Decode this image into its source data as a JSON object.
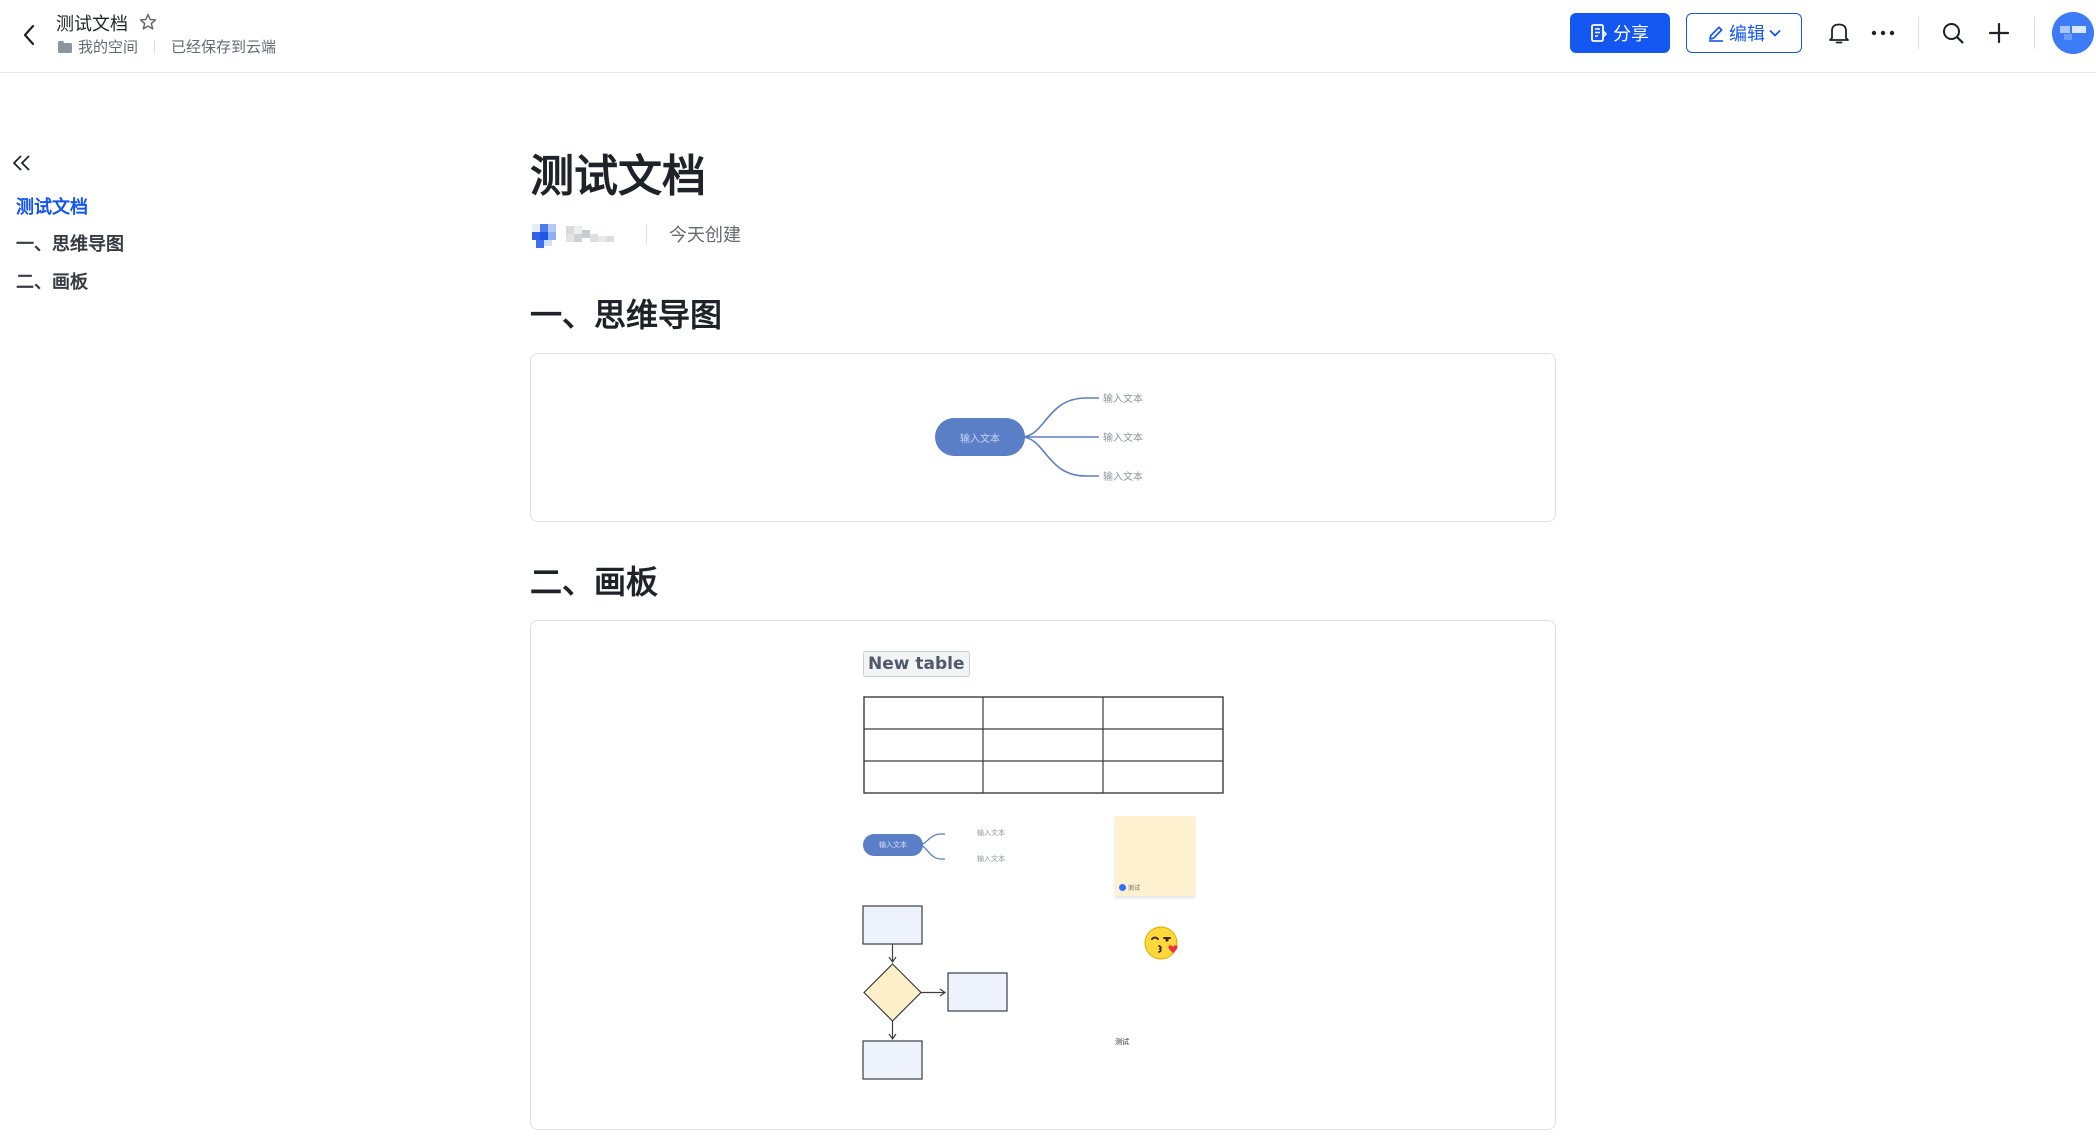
{
  "header": {
    "doc_title": "测试文档",
    "breadcrumb_space": "我的空间",
    "save_status": "已经保存到云端",
    "share_label": "分享",
    "edit_label": "编辑"
  },
  "outline": {
    "items": [
      {
        "label": "测试文档"
      },
      {
        "label": "一、思维导图"
      },
      {
        "label": "二、画板"
      }
    ]
  },
  "doc": {
    "title": "测试文档",
    "created": "今天创建",
    "sections": [
      {
        "heading": "一、思维导图"
      },
      {
        "heading": "二、画板"
      }
    ],
    "mindmap": {
      "root": "输入文本",
      "children": [
        "输入文本",
        "输入文本",
        "输入文本"
      ]
    },
    "board": {
      "table_title": "New table",
      "mini_mindmap": {
        "root": "输入文本",
        "children": [
          "输入文本",
          "输入文本"
        ]
      },
      "sticky_author": "测试",
      "text_label": "测试"
    }
  },
  "colors": {
    "accent": "#1456f0",
    "mindmap_node": "#5b7fc7",
    "sticky": "#fdf1cf",
    "diamond": "#fdf0c8",
    "flow_box": "#eef2fb"
  },
  "icons": [
    "back-arrow-icon",
    "star-icon",
    "folder-icon",
    "share-doc-icon",
    "pencil-icon",
    "chevron-down-icon",
    "bell-icon",
    "more-icon",
    "search-icon",
    "plus-icon",
    "double-chevron-left-icon",
    "emoji-kiss-icon"
  ]
}
